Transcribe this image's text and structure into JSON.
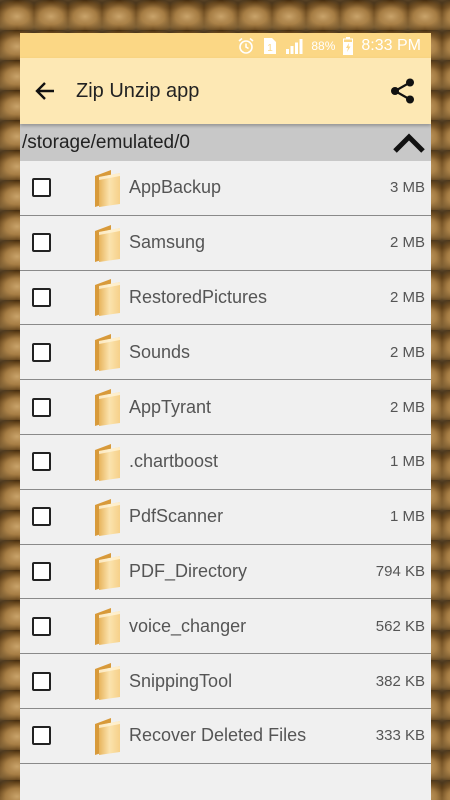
{
  "status_bar": {
    "battery": "88%",
    "time": "8:33 PM",
    "sim_badge": "1"
  },
  "toolbar": {
    "title": "Zip Unzip app",
    "back_icon": "back-arrow-icon",
    "share_icon": "share-icon"
  },
  "path_bar": {
    "path": "/storage/emulated/0",
    "collapse_icon": "chevron-up-icon"
  },
  "files": [
    {
      "name": "AppBackup",
      "size": "3 MB"
    },
    {
      "name": "Samsung",
      "size": "2 MB"
    },
    {
      "name": "RestoredPictures",
      "size": "2 MB"
    },
    {
      "name": "Sounds",
      "size": "2 MB"
    },
    {
      "name": "AppTyrant",
      "size": "2 MB"
    },
    {
      "name": ".chartboost",
      "size": "1 MB"
    },
    {
      "name": "PdfScanner",
      "size": "1 MB"
    },
    {
      "name": "PDF_Directory",
      "size": "794 KB"
    },
    {
      "name": "voice_changer",
      "size": "562 KB"
    },
    {
      "name": "SnippingTool",
      "size": "382 KB"
    },
    {
      "name": "Recover Deleted Files",
      "size": "333 KB"
    }
  ],
  "colors": {
    "status_bar": "#fbd785",
    "toolbar": "#fde8b4",
    "path_bar": "#c8c8c8",
    "list_bg": "#f0f0f0"
  }
}
